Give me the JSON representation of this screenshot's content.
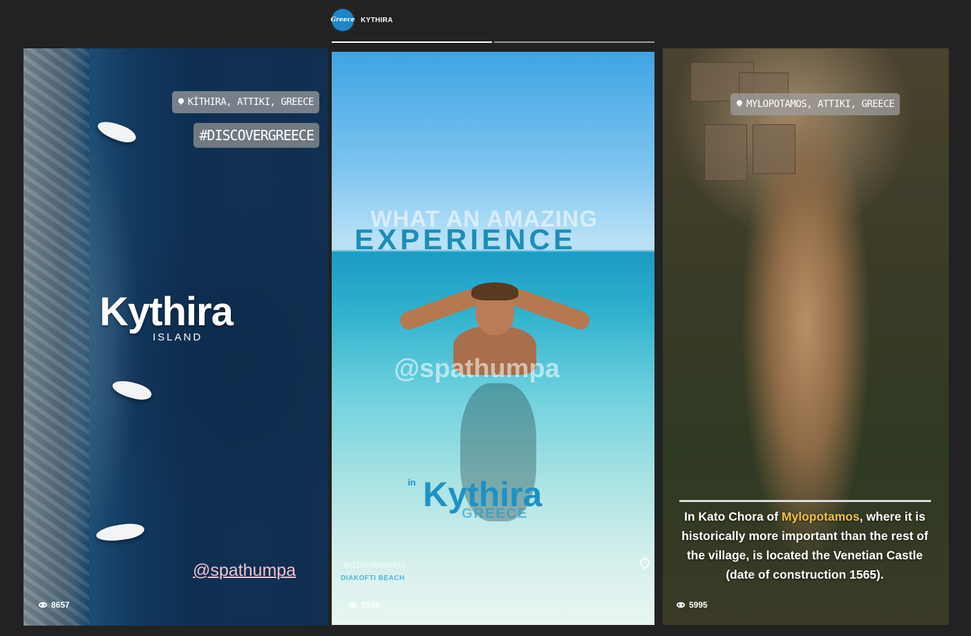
{
  "header": {
    "avatar_text": "Greece",
    "title": "KYTHIRA",
    "progress_segments": 2,
    "active_segment": 0
  },
  "stories": [
    {
      "location": "KÍTHIRA, ATTIKI, GREECE",
      "hashtag": "#DISCOVERGREECE",
      "title": "Kythira",
      "subtitle": "ISLAND",
      "mention": "@spathumpa",
      "views": "8657"
    },
    {
      "headline_top": "WHAT AN AMAZING",
      "headline_big": "EXPERIENCE",
      "mention": "@spathumpa",
      "in_label": "in",
      "title": "Kythira",
      "subtitle": "GREECE",
      "hashtag": "#DISCOVERGREECE",
      "place": "DIAKOFTI BEACH",
      "views": "5558"
    },
    {
      "location": "MYLOPOTAMOS, ATTIKI, GREECE",
      "caption_before": "In Kato Chora of ",
      "caption_highlight": "Mylopotamos",
      "caption_after": ", where it is historically more important than the rest of the village, is located the Venetian Castle (date of construction 1565).",
      "views": "5995"
    }
  ],
  "colors": {
    "background": "#222222",
    "highlight": "#f0c040",
    "kythira_blue": "#1d92c6",
    "mention_pink": "#f4c0cf"
  }
}
